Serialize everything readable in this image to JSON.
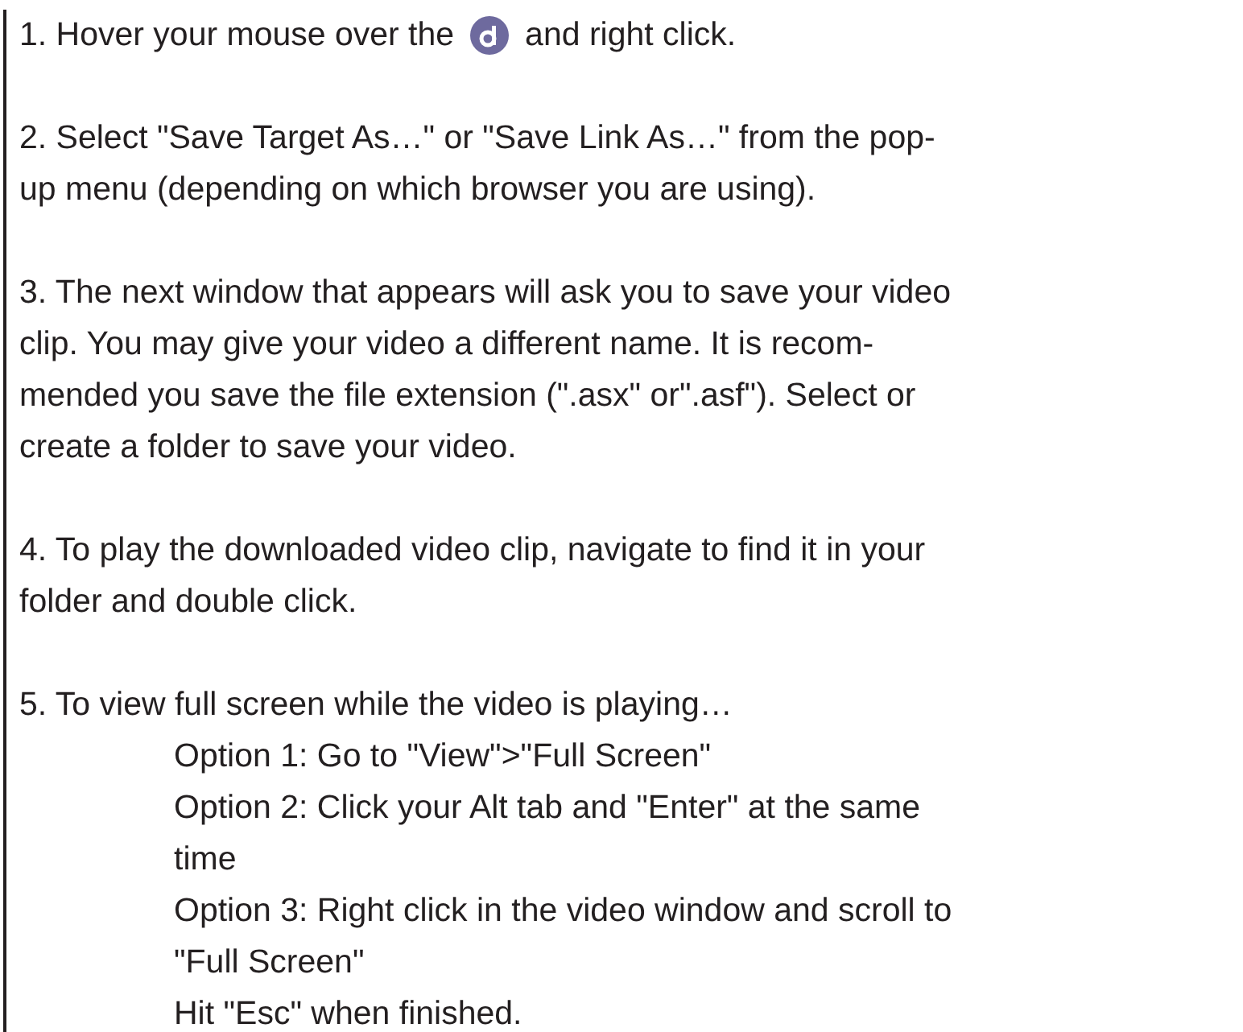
{
  "steps": [
    {
      "lines": [
        "1. Hover your mouse over the",
        "and right click."
      ],
      "inline_icon": true
    },
    {
      "lines": [
        "2. Select \"Save Target As…\" or \"Save Link As…\" from the pop-",
        "up menu (depending on which browser you are using)."
      ]
    },
    {
      "lines": [
        "3. The next window that appears will ask you to save your video",
        "clip. You may give your video a different name. It is recom-",
        "mended you save the file extension (\".asx\" or\".asf\"). Select or",
        "create a folder to save your video."
      ]
    },
    {
      "lines": [
        "4. To play the downloaded video clip, navigate to find it in your",
        "folder and double click."
      ]
    },
    {
      "lines": [
        "5. To view full screen while the video is playing…"
      ],
      "options": [
        {
          "lines": [
            "Option 1: Go to \"View\">\"Full Screen\""
          ]
        },
        {
          "lines": [
            "Option 2: Click your Alt tab and \"Enter\" at the same",
            "time"
          ]
        },
        {
          "lines": [
            "Option 3: Right click in the video window and scroll to",
            "\"Full Screen\""
          ]
        },
        {
          "lines": [
            "Hit \"Esc\" when finished."
          ]
        }
      ]
    }
  ]
}
